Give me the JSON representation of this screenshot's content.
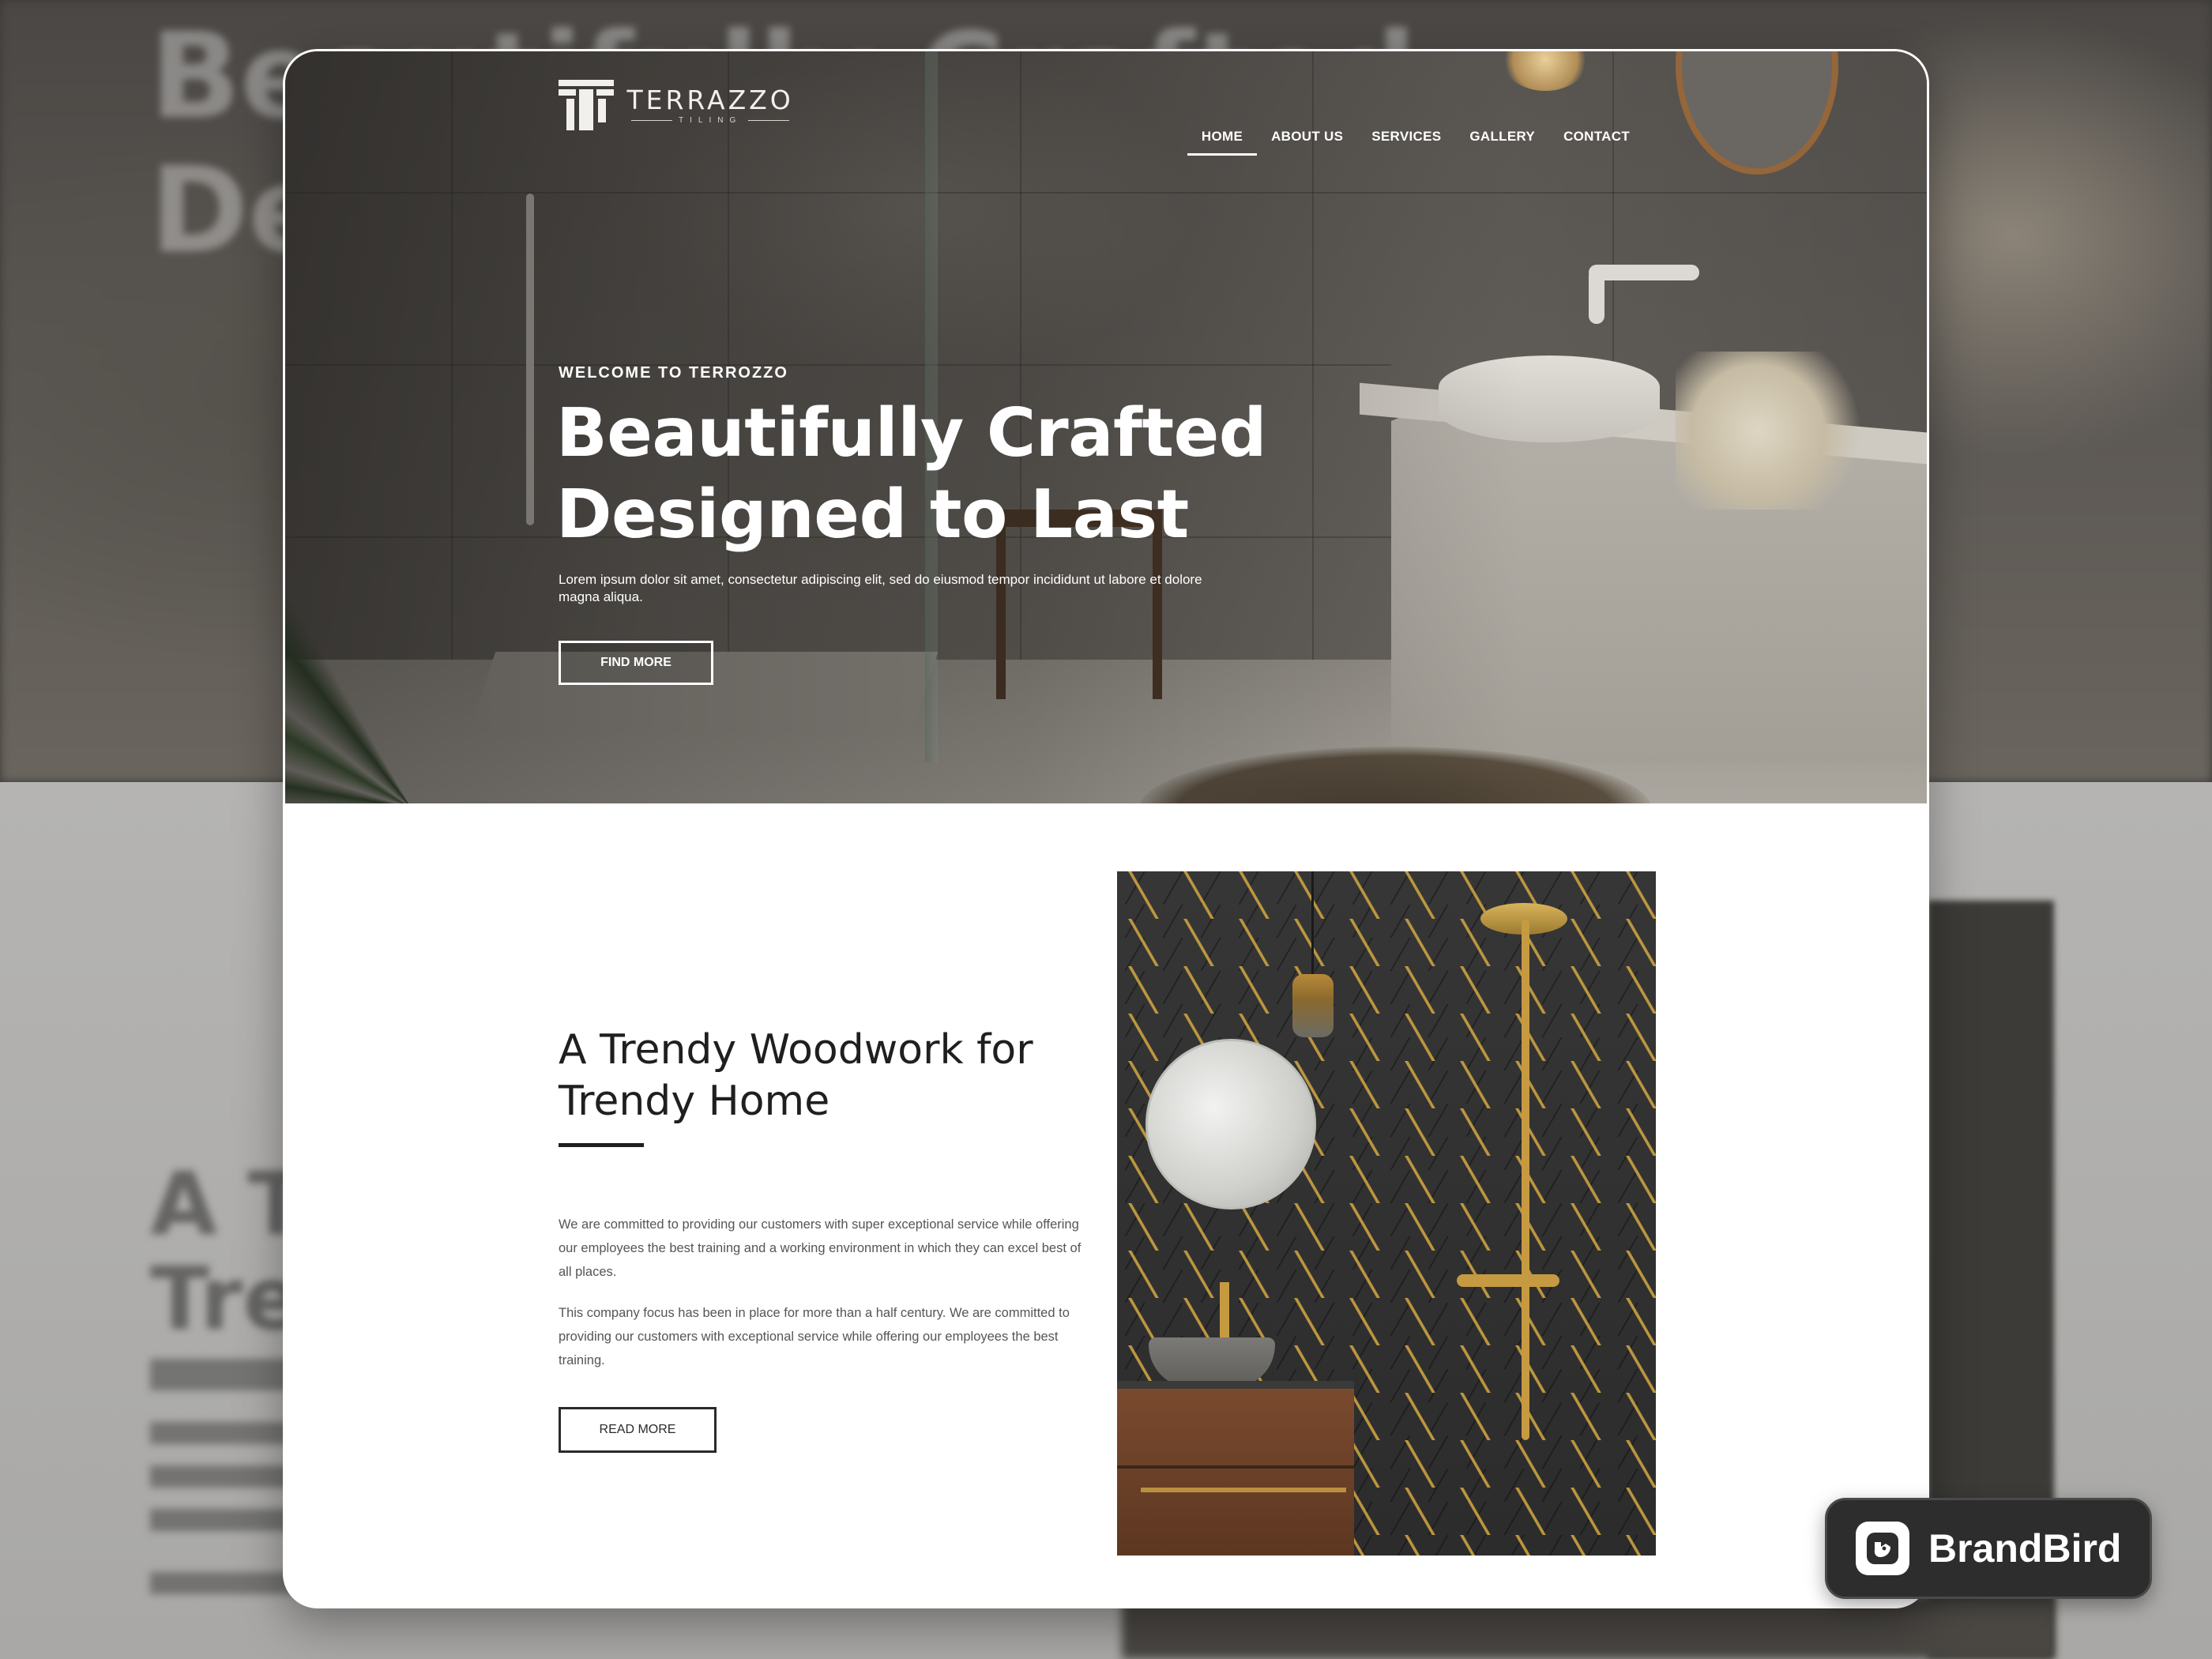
{
  "brand": {
    "logo_name": "TERRAZZO",
    "logo_sub": "TILING"
  },
  "nav": {
    "items": [
      {
        "label": "HOME",
        "active": true
      },
      {
        "label": "ABOUT US",
        "active": false
      },
      {
        "label": "SERVICES",
        "active": false
      },
      {
        "label": "GALLERY",
        "active": false
      },
      {
        "label": "CONTACT",
        "active": false
      }
    ]
  },
  "hero": {
    "eyebrow": "WELCOME TO TERROZZO",
    "title_line1": "Beautifully Crafted",
    "title_line2": "Designed to Last",
    "description": "Lorem ipsum dolor sit amet, consectetur adipiscing elit, sed do eiusmod tempor incididunt ut labore et dolore magna aliqua.",
    "cta_label": "FIND MORE"
  },
  "about": {
    "title_line1": "A Trendy Woodwork for",
    "title_line2": "Trendy Home",
    "paragraph1": "We are committed to providing our customers with super exceptional service while offering our employees the best training and a working environment in which they can excel best of all places.",
    "paragraph2": "This company focus has been in place for more than a half century. We are committed to providing our customers with exceptional service while offering our employees the best training.",
    "cta_label": "READ MORE"
  },
  "badge": {
    "label": "BrandBird"
  },
  "colors": {
    "text_dark": "#1f1f1f",
    "text_body": "#555555",
    "white": "#ffffff",
    "badge_bg": "#2d2d2d",
    "gold_accent": "#c59a40"
  },
  "icons": {
    "logo_mark": "terrazzo-t-logo-icon",
    "badge_icon": "brandbird-bird-icon"
  }
}
